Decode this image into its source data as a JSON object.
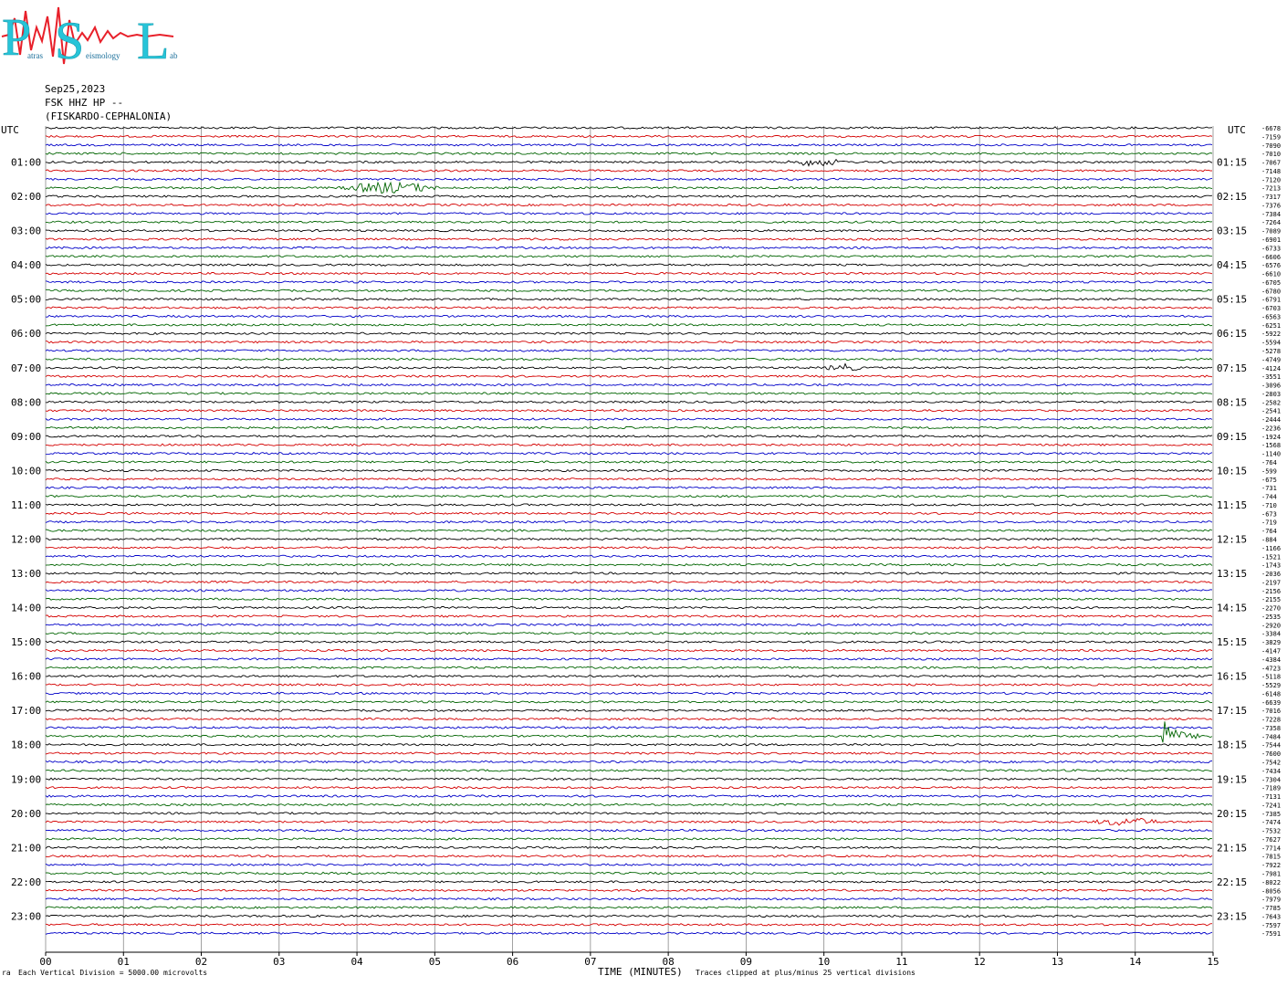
{
  "logo": {
    "big_letters": [
      "P",
      "S",
      "L"
    ],
    "small_words": [
      "atras",
      "eismology",
      "ab"
    ],
    "colors": {
      "letters": "#27c4d8",
      "trace": "#e8202a"
    }
  },
  "header": {
    "date": "Sep25,2023",
    "station": "FSK HHZ HP --",
    "location": "(FISKARDO-CEPHALONIA)"
  },
  "chart_data": {
    "type": "line",
    "title": "",
    "left_axis_title": "UTC",
    "right_axis_title": "UTC",
    "left_hour_labels": [
      "01:00",
      "02:00",
      "03:00",
      "04:00",
      "05:00",
      "06:00",
      "07:00",
      "08:00",
      "09:00",
      "10:00",
      "11:00",
      "12:00",
      "13:00",
      "14:00",
      "15:00",
      "16:00",
      "17:00",
      "18:00",
      "19:00",
      "20:00",
      "21:00",
      "22:00",
      "23:00"
    ],
    "right_hour_labels": [
      "01:15",
      "02:15",
      "03:15",
      "04:15",
      "05:15",
      "06:15",
      "07:15",
      "08:15",
      "09:15",
      "10:15",
      "11:15",
      "12:15",
      "13:15",
      "14:15",
      "15:15",
      "16:15",
      "17:15",
      "18:15",
      "19:15",
      "20:15",
      "21:15",
      "22:15",
      "23:15"
    ],
    "x_tick_labels": [
      "00",
      "01",
      "02",
      "03",
      "04",
      "05",
      "06",
      "07",
      "08",
      "09",
      "10",
      "11",
      "12",
      "13",
      "14",
      "15"
    ],
    "xlim": [
      0,
      15
    ],
    "xlabel": "TIME (MINUTES)",
    "trace_minutes": 15,
    "trace_colors": [
      "#000000",
      "#d40000",
      "#0000c8",
      "#006400"
    ],
    "grid": true,
    "right_offset_values": [
      -6678,
      -7159,
      -7090,
      -7010,
      -7067,
      -7148,
      -7120,
      -7213,
      -7317,
      -7376,
      -7384,
      -7264,
      -7089,
      -6901,
      -6733,
      -6606,
      -6576,
      -6610,
      -6705,
      -6780,
      -6791,
      -6703,
      -6563,
      -6251,
      -5922,
      -5594,
      -5278,
      -4749,
      -4124,
      -3551,
      -3096,
      -2803,
      -2582,
      -2541,
      -2444,
      -2236,
      -1924,
      -1568,
      -1140,
      -764,
      -599,
      -675,
      -731,
      -744,
      -710,
      -673,
      -719,
      -764,
      -884,
      -1166,
      -1521,
      -1743,
      -2036,
      -2197,
      -2156,
      -2155,
      -2270,
      -2535,
      -2920,
      -3384,
      -3829,
      -4147,
      -4384,
      -4723,
      -5118,
      -5529,
      -6148,
      -6639,
      -7016,
      -7228,
      -7358,
      -7484,
      -7544,
      -7600,
      -7542,
      -7434,
      -7304,
      -7189,
      -7131,
      -7241,
      -7385,
      -7474,
      -7532,
      -7627,
      -7714,
      -7815,
      -7922,
      -7981,
      -8022,
      -8056,
      -7979,
      -7785,
      -7643,
      -7597,
      -7591
    ],
    "events": [
      {
        "trace": 4,
        "start_min": 9.5,
        "end_min": 10.8,
        "amplitude": "small"
      },
      {
        "trace": 7,
        "start_min": 3.75,
        "end_min": 5.9,
        "amplitude": "medium"
      },
      {
        "trace": 28,
        "start_min": 10.0,
        "end_min": 10.8,
        "amplitude": "small"
      },
      {
        "trace": 71,
        "start_min": 14.35,
        "end_min": 15.0,
        "amplitude": "large"
      },
      {
        "trace": 81,
        "start_min": 13.4,
        "end_min": 15.0,
        "amplitude": "small"
      }
    ]
  },
  "footer": {
    "vertical_division": "Each Vertical Division = 5000.00 microvolts",
    "clip_note": "Traces clipped at plus/minus 25 vertical divisions",
    "corner_mark": "ra"
  }
}
